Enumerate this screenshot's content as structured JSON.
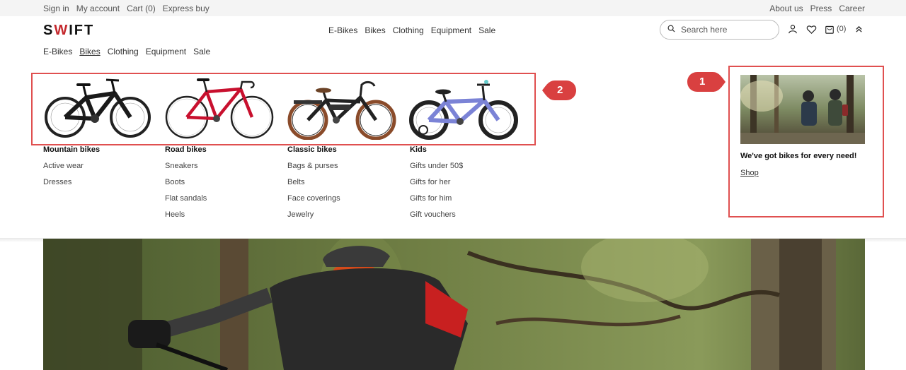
{
  "utility": {
    "left": [
      "Sign in",
      "My account",
      "Cart (0)",
      "Express buy"
    ],
    "right": [
      "About us",
      "Press",
      "Career"
    ]
  },
  "header": {
    "logo_prefix": "S",
    "logo_mark": "W",
    "logo_suffix": "IFT",
    "nav": [
      "E-Bikes",
      "Bikes",
      "Clothing",
      "Equipment",
      "Sale"
    ],
    "search_placeholder": "Search here",
    "cart_count": "(0)"
  },
  "subnav": {
    "items": [
      "E-Bikes",
      "Bikes",
      "Clothing",
      "Equipment",
      "Sale"
    ],
    "active": "Bikes"
  },
  "menu": {
    "columns": [
      {
        "heading": "Mountain bikes",
        "items": [
          "Active wear",
          "Dresses"
        ]
      },
      {
        "heading": "Road bikes",
        "items": [
          "Sneakers",
          "Boots",
          "Flat sandals",
          "Heels"
        ]
      },
      {
        "heading": "Classic bikes",
        "items": [
          "Bags & purses",
          "Belts",
          "Face coverings",
          "Jewelry"
        ]
      },
      {
        "heading": "Kids",
        "items": [
          "Gifts under 50$",
          "Gifts for her",
          "Gifts for him",
          "Gift vouchers"
        ]
      }
    ]
  },
  "promo": {
    "title": "We've got bikes for every need!",
    "link": "Shop"
  },
  "annotations": {
    "badge1": "1",
    "badge2": "2",
    "color": "#e05050"
  }
}
